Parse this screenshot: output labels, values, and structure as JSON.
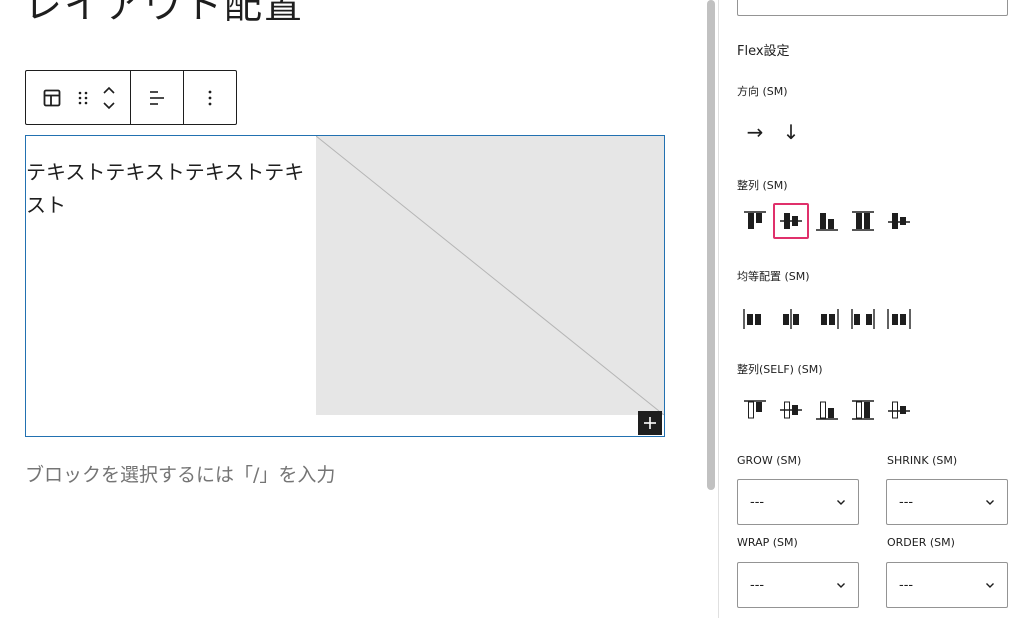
{
  "editor": {
    "title": "レイアウト配置",
    "toolbar": {
      "block_type_icon": "layout-icon",
      "drag_icon": "drag-handle-icon",
      "move_icon": "move-up-down-icon",
      "align_icon": "justify-left-icon",
      "more_icon": "more-vertical-icon"
    },
    "block_text": "テキストテキストテキストテキスト",
    "add_button_label": "+",
    "append_placeholder": "ブロックを選択するには「/」を入力"
  },
  "sidebar": {
    "flex_title": "Flex設定",
    "direction_label": "方向 (SM)",
    "direction_options": [
      "→",
      "↓"
    ],
    "align_label": "整列 (SM)",
    "justify_label": "均等配置 (SM)",
    "align_self_label": "整列(SELF) (SM)",
    "grow_label": "GROW (SM)",
    "shrink_label": "SHRINK (SM)",
    "wrap_label": "WRAP (SM)",
    "order_label": "ORDER (SM)",
    "grow_value": "---",
    "shrink_value": "---",
    "wrap_value": "---",
    "order_value": "---",
    "selected_align_index": 1,
    "highlight_color": "#e0306b"
  },
  "colors": {
    "selection_border": "#2271b1",
    "placeholder_bg": "#e6e6e6",
    "muted_text": "#757575"
  }
}
